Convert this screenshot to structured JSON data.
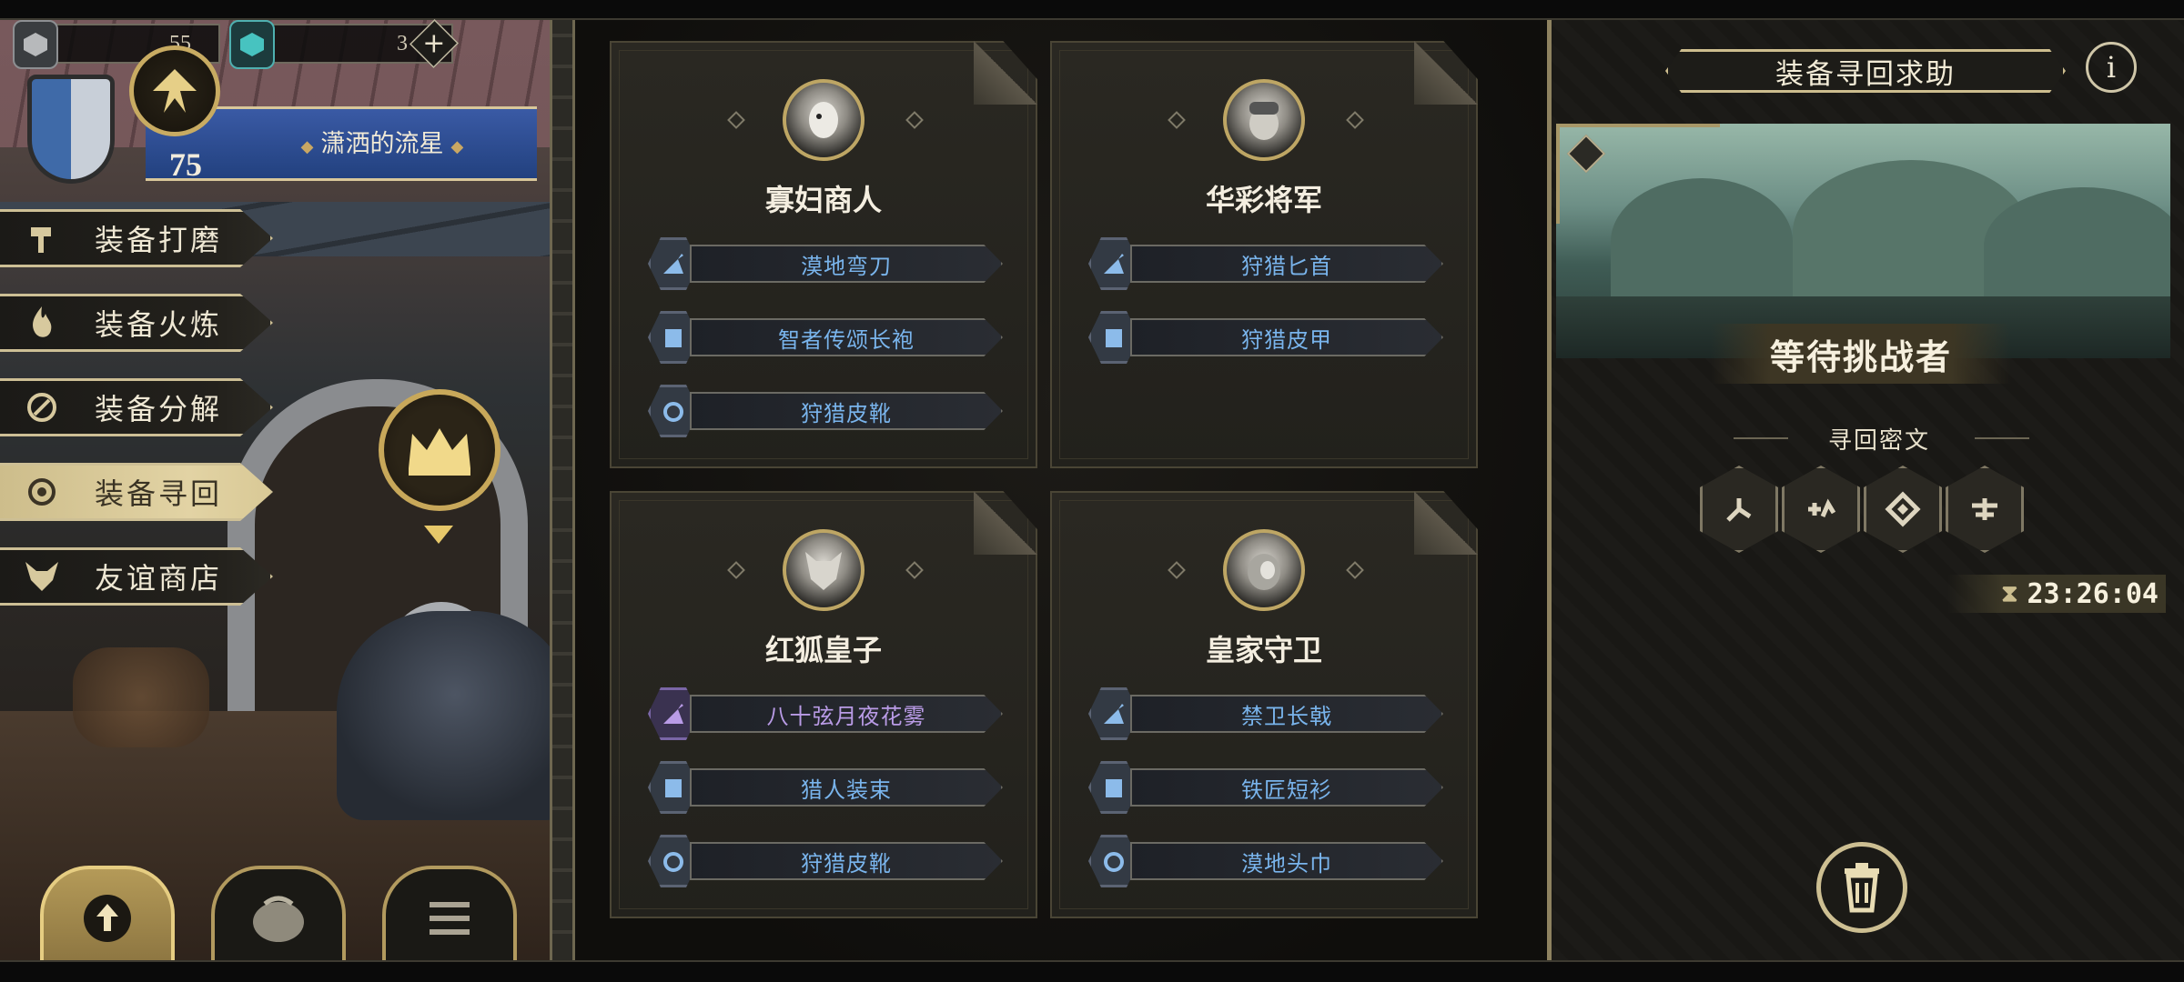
{
  "player": {
    "resource_1": "55",
    "resource_2": "3",
    "level": "75",
    "title": "潇洒的流星"
  },
  "menu": [
    {
      "label": "装备打磨",
      "icon": "hammer-icon"
    },
    {
      "label": "装备火炼",
      "icon": "flame-icon"
    },
    {
      "label": "装备分解",
      "icon": "disassemble-icon"
    },
    {
      "label": "装备寻回",
      "icon": "recover-icon",
      "active": true
    },
    {
      "label": "友谊商店",
      "icon": "fox-icon"
    }
  ],
  "cards": [
    {
      "name": "寡妇商人",
      "items": [
        {
          "label": "漠地弯刀",
          "icon": "sword-icon",
          "color": "blue"
        },
        {
          "label": "智者传颂长袍",
          "icon": "armor-icon",
          "color": "blue"
        },
        {
          "label": "狩猎皮靴",
          "icon": "ring-icon",
          "color": "blue"
        }
      ]
    },
    {
      "name": "华彩将军",
      "items": [
        {
          "label": "狩猎匕首",
          "icon": "sword-icon",
          "color": "blue"
        },
        {
          "label": "狩猎皮甲",
          "icon": "armor-icon",
          "color": "blue"
        }
      ]
    },
    {
      "name": "红狐皇子",
      "items": [
        {
          "label": "八十弦月夜花雾",
          "icon": "sword-icon",
          "color": "purple"
        },
        {
          "label": "猎人装束",
          "icon": "armor-icon",
          "color": "blue"
        },
        {
          "label": "狩猎皮靴",
          "icon": "ring-icon",
          "color": "blue"
        }
      ]
    },
    {
      "name": "皇家守卫",
      "items": [
        {
          "label": "禁卫长戟",
          "icon": "sword-icon",
          "color": "blue"
        },
        {
          "label": "铁匠短衫",
          "icon": "armor-icon",
          "color": "blue"
        },
        {
          "label": "漠地头巾",
          "icon": "ring-icon",
          "color": "blue"
        }
      ]
    }
  ],
  "right_panel": {
    "title": "装备寻回求助",
    "status": "等待挑战者",
    "cipher_title": "寻回密文",
    "timer": "23:26:04"
  },
  "colors": {
    "accent_gold": "#cdbd8e",
    "item_blue": "#79b4ec",
    "item_purple": "#b99be6",
    "panel_dark": "#1c1b18"
  }
}
